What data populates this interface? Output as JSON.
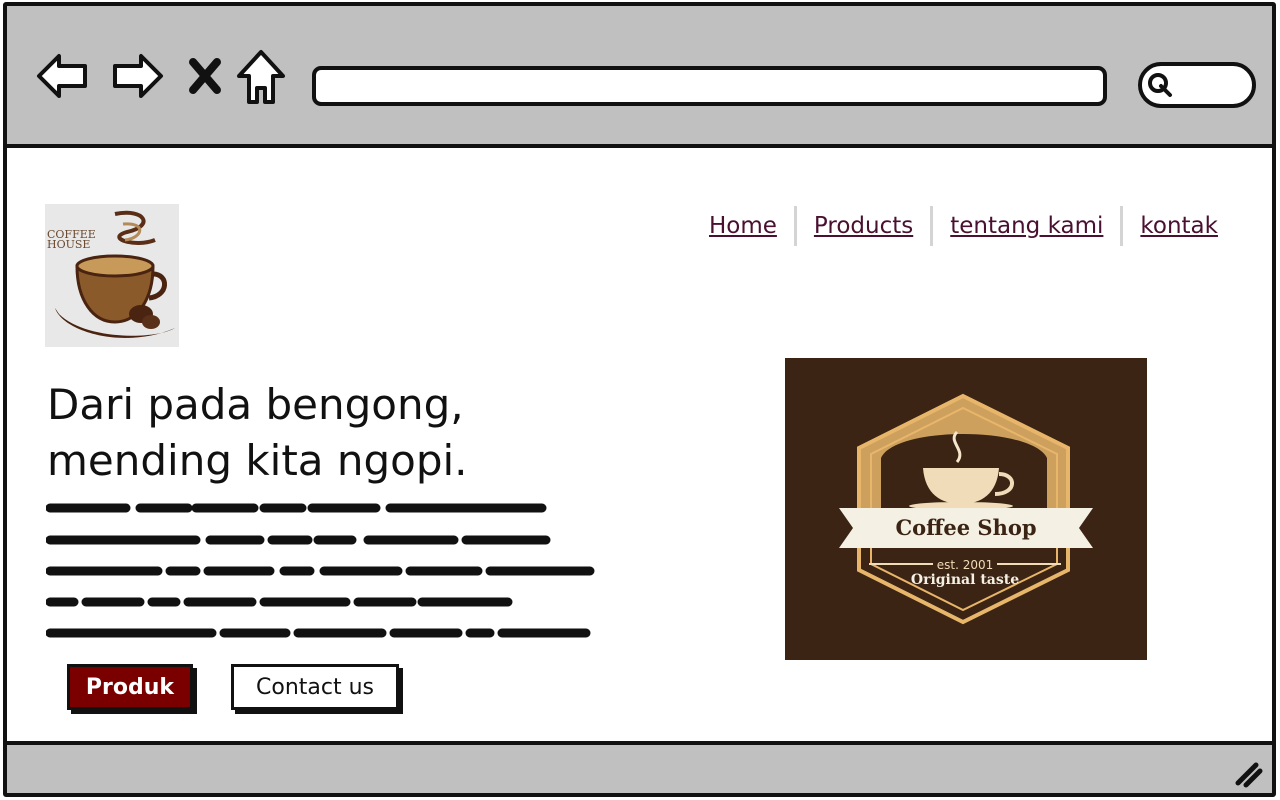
{
  "browser": {
    "url": "",
    "search_placeholder": ""
  },
  "site": {
    "logo_text_line1": "COFFEE",
    "logo_text_line2": "HOUSE"
  },
  "nav": {
    "items": [
      {
        "label": "Home"
      },
      {
        "label": "Products"
      },
      {
        "label": "tentang kami"
      },
      {
        "label": "kontak"
      }
    ]
  },
  "hero": {
    "headline_line1": "Dari pada bengong,",
    "headline_line2": "mending kita ngopi.",
    "primary_button": "Produk",
    "secondary_button": "Contact us"
  },
  "badge": {
    "title": "Coffee Shop",
    "est": "est. 2001",
    "tagline": "Original taste"
  },
  "colors": {
    "toolbar": "#c0c0c0",
    "nav_link": "#4a1030",
    "primary_button": "#7a0000",
    "badge_bg": "#3b2414",
    "badge_gold": "#e8b66a"
  }
}
